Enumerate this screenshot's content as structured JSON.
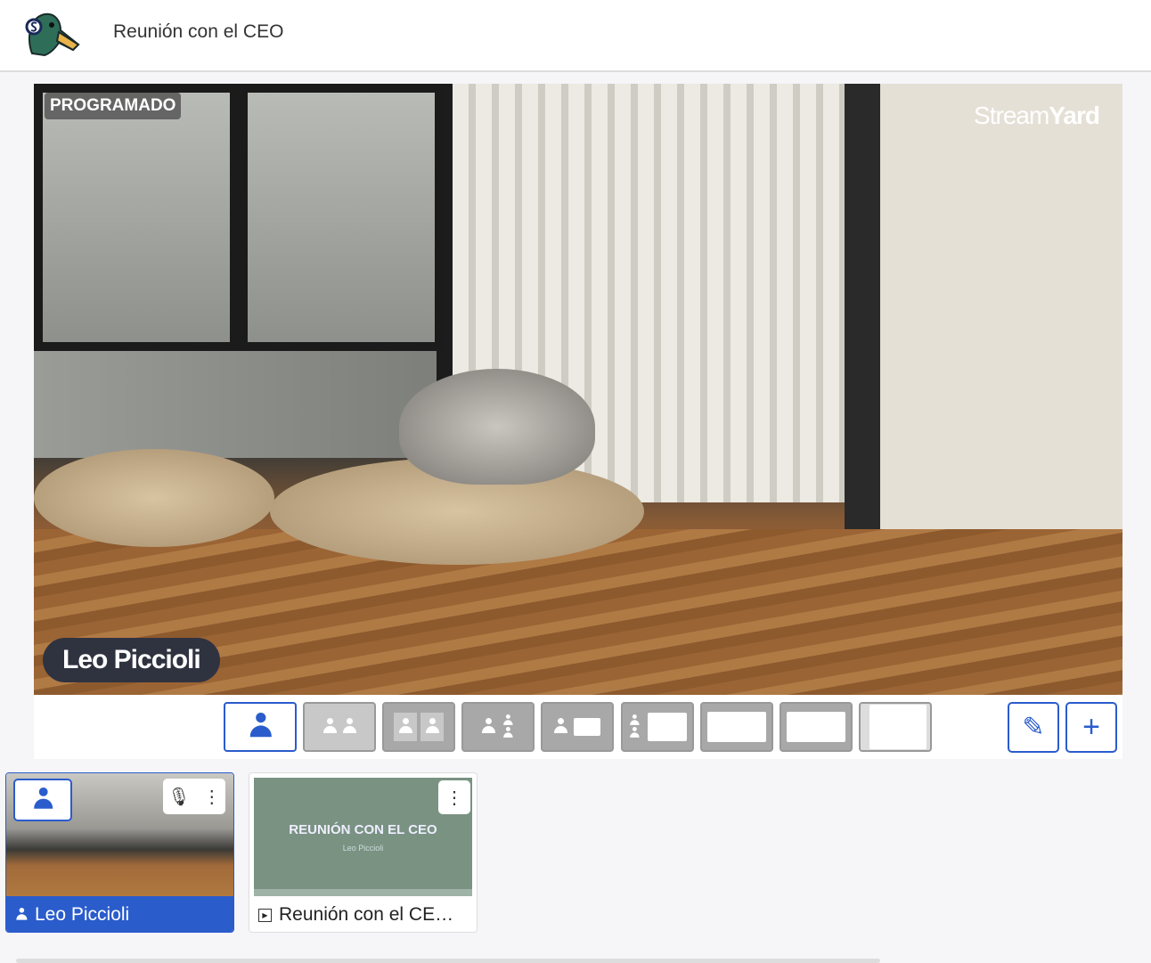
{
  "header": {
    "title": "Reunión con el CEO",
    "logo_icon": "streamyard-duck-logo"
  },
  "stage": {
    "status_badge": "PROGRAMADO",
    "brand_a": "Stream",
    "brand_b": "Yard",
    "name_tag": "Leo Piccioli"
  },
  "layouts": [
    "solo",
    "cropped",
    "group",
    "leader",
    "news",
    "screen",
    "picture-in-picture",
    "cinema",
    "thin"
  ],
  "selected_layout": "solo",
  "actions": {
    "edit_icon": "pencil-icon",
    "add_icon": "plus-icon"
  },
  "cards": [
    {
      "label": "Leo Piccioli",
      "selected": true
    },
    {
      "label": "Reunión con el CE…",
      "slide_title": "REUNIÓN CON EL CEO",
      "slide_subtitle": "Leo Piccioli"
    }
  ],
  "colors": {
    "accent": "#2a5ccc",
    "slide_bg": "#7a9282"
  }
}
